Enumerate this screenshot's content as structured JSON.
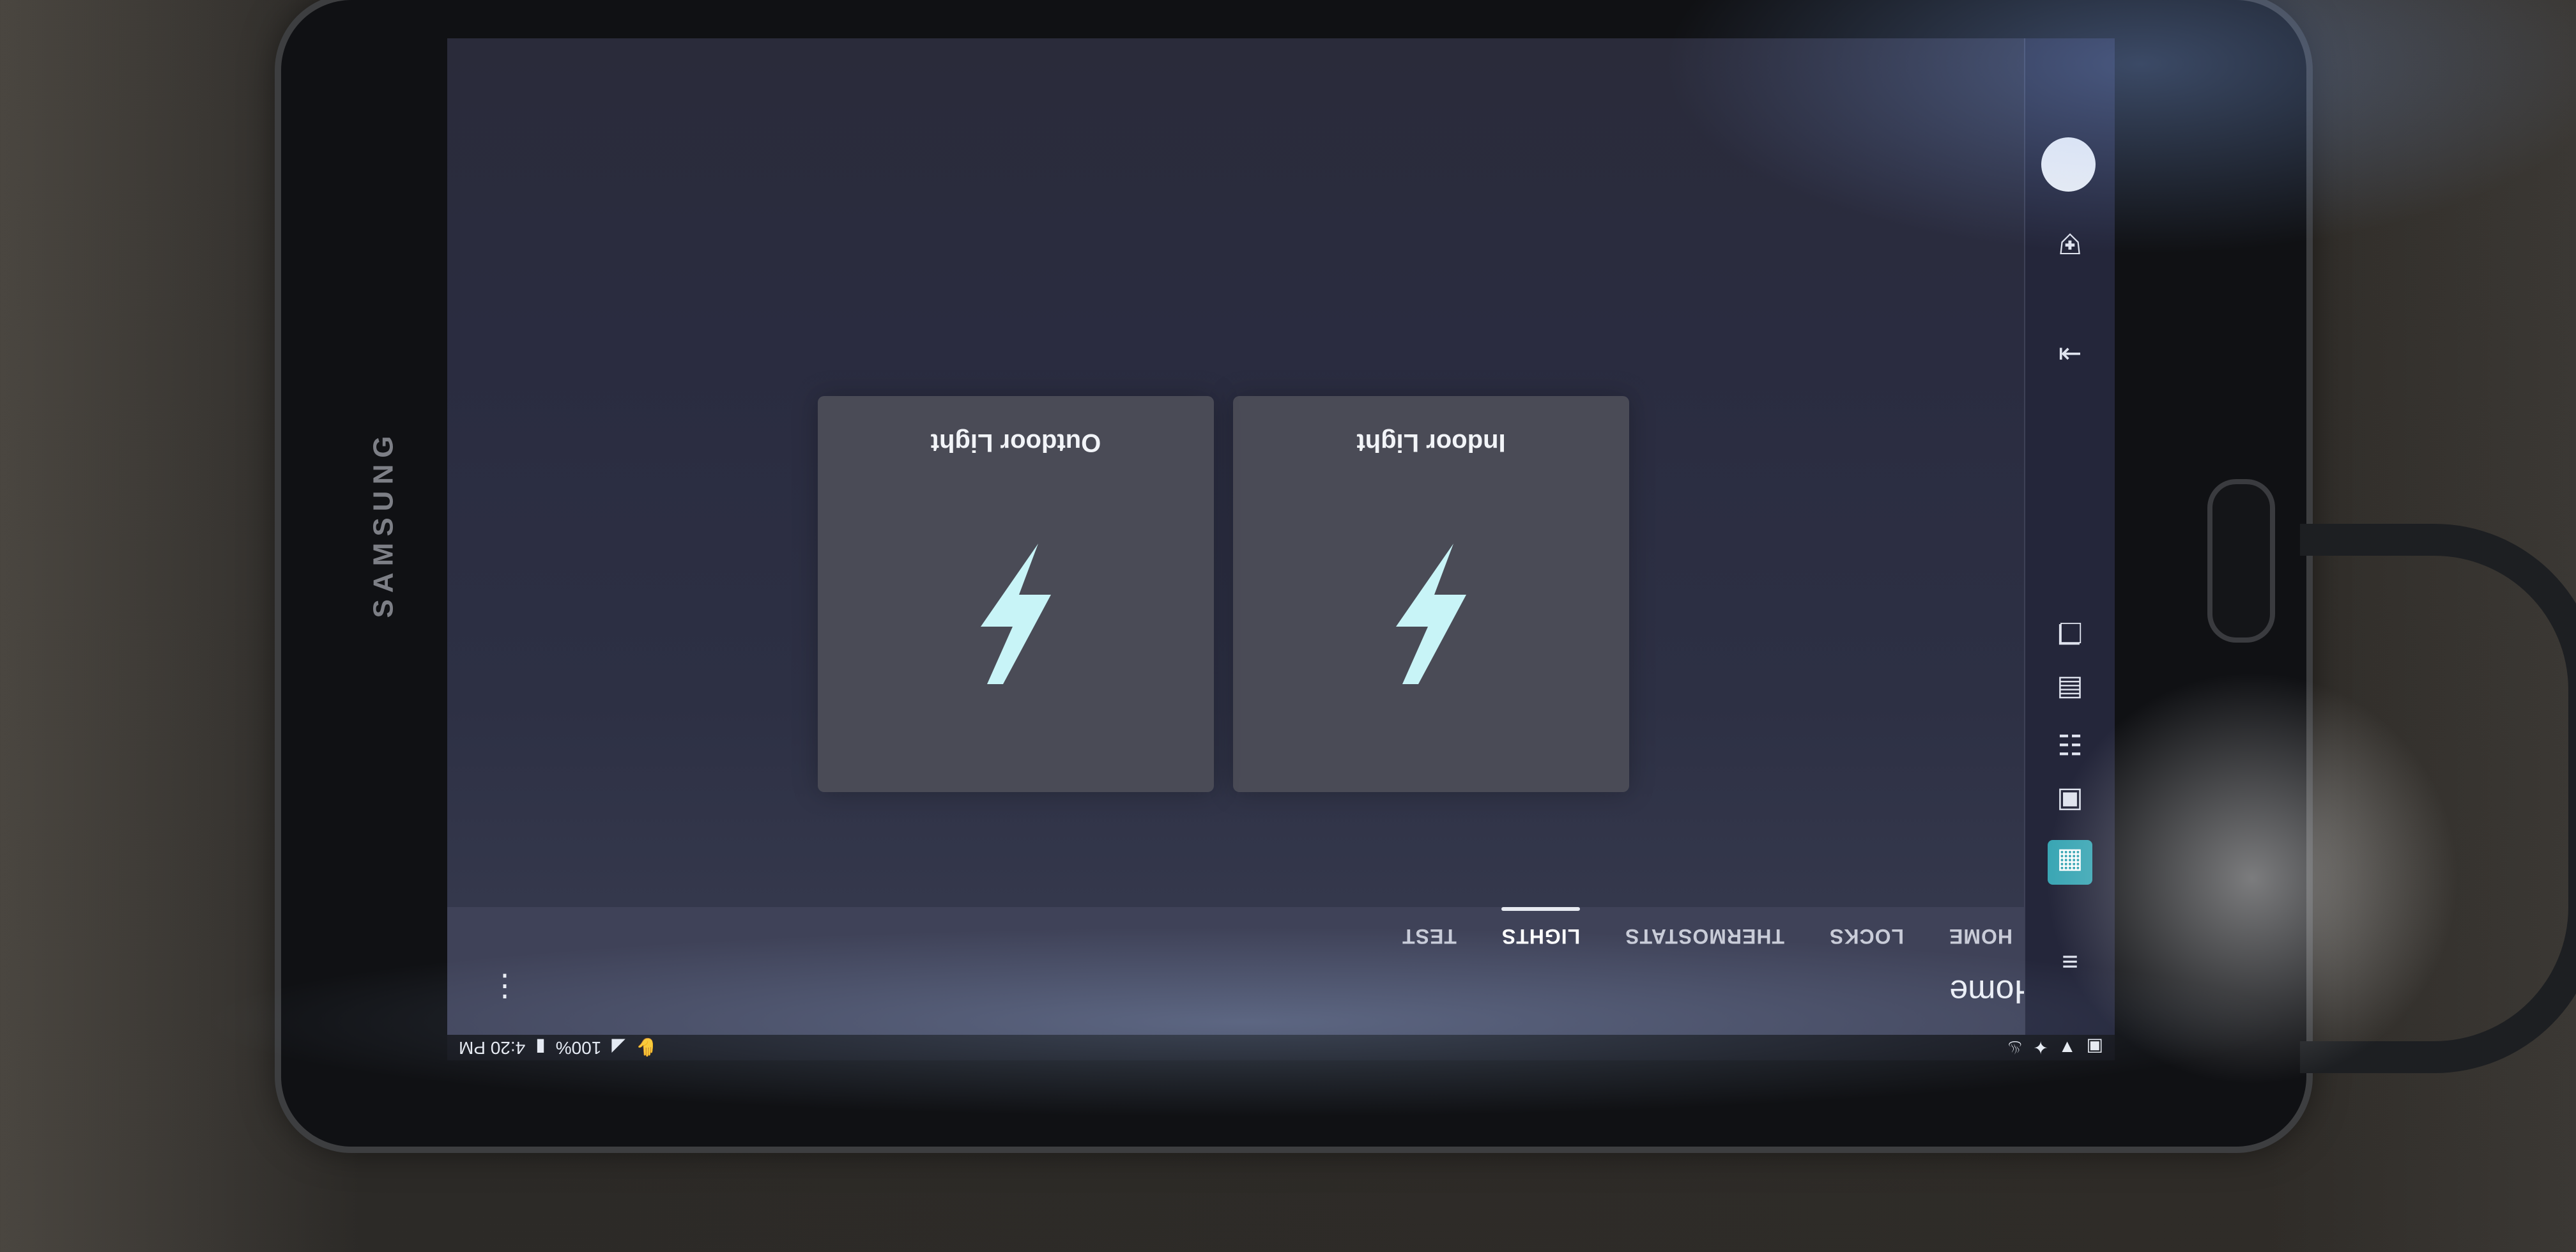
{
  "device": {
    "brand": "SAMSUNG"
  },
  "status_bar": {
    "time": "4:20 PM",
    "battery": "100%",
    "left_icons": [
      "hand-icon",
      "no-signal-icon",
      "battery-icon"
    ],
    "right_icons": [
      "fire-icon",
      "sparkle-icon",
      "wifi-icon",
      "notification-icon"
    ]
  },
  "app_bar": {
    "title": "Home",
    "menu_icon": "hamburger-icon",
    "more_icon": "more-vertical-icon"
  },
  "tabs": [
    {
      "label": "HOME",
      "active": false
    },
    {
      "label": "LOCKS",
      "active": false
    },
    {
      "label": "THERMOSTATS",
      "active": false
    },
    {
      "label": "LIGHTS",
      "active": true
    },
    {
      "label": "TEST",
      "active": false
    }
  ],
  "sidebar": {
    "items": [
      "dashboard-icon",
      "calendar-icon",
      "list-icon",
      "card-icon",
      "copy-icon",
      "logout-icon",
      "shield-icon",
      "avatar"
    ]
  },
  "tiles": [
    {
      "label": "Indoor Light",
      "icon": "bolt-icon"
    },
    {
      "label": "Outdoor Light",
      "icon": "bolt-icon"
    }
  ],
  "colors": {
    "accent": "#3aa6b4",
    "bolt": "#c8f4f7",
    "tile": "#4a4b56",
    "appbar": "#3f4258"
  }
}
